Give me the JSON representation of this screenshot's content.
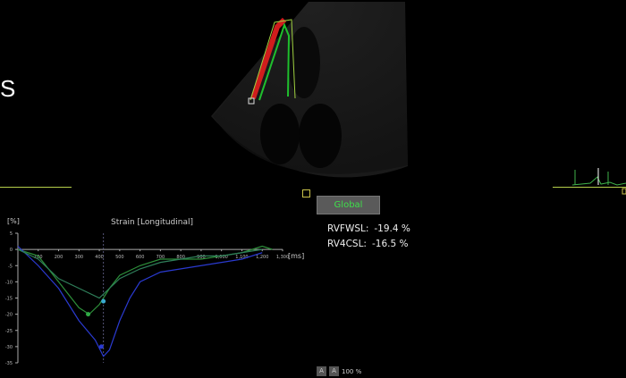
{
  "view_letter": "S",
  "global_button": "Global",
  "measurements": [
    {
      "label": "RVFWSL:",
      "value": "-19.4 %"
    },
    {
      "label": "RV4CSL:",
      "value": "-16.5 %"
    }
  ],
  "chart": {
    "title": "Strain [Longitudinal]",
    "ylabel": "[%]",
    "xunit": "[ms]"
  },
  "zoom": {
    "btn1": "A",
    "btn2": "A",
    "level": "100 %"
  },
  "chart_data": {
    "type": "line",
    "title": "Strain [Longitudinal]",
    "xlabel": "[ms]",
    "ylabel": "[%]",
    "xlim": [
      0,
      1300
    ],
    "ylim": [
      -35,
      5
    ],
    "x_ticks": [
      100,
      200,
      300,
      400,
      500,
      600,
      700,
      800,
      900,
      "1,000",
      "1,100",
      "1,200",
      "1,300"
    ],
    "y_ticks": [
      5,
      0,
      -5,
      -10,
      -15,
      -20,
      -25,
      -30,
      -35
    ],
    "series": [
      {
        "color": "#2d8f3a",
        "x": [
          0,
          100,
          200,
          300,
          350,
          400,
          450,
          500,
          600,
          700,
          800,
          900,
          1000,
          1100,
          1200,
          1250
        ],
        "y": [
          0,
          -2,
          -10,
          -18,
          -20,
          -17,
          -12,
          -8,
          -5,
          -3,
          -3,
          -3,
          -2,
          -1,
          1,
          0
        ]
      },
      {
        "color": "#2a3ad0",
        "x": [
          0,
          100,
          200,
          300,
          380,
          420,
          450,
          500,
          550,
          600,
          700,
          800,
          900,
          1000,
          1100,
          1200
        ],
        "y": [
          1,
          -5,
          -12,
          -22,
          -28,
          -33,
          -31,
          -22,
          -15,
          -10,
          -7,
          -6,
          -5,
          -4,
          -3,
          -1
        ]
      },
      {
        "color": "#2f7f5a",
        "x": [
          0,
          100,
          200,
          300,
          400,
          450,
          500,
          600,
          700,
          800,
          900,
          1000,
          1100,
          1200
        ],
        "y": [
          0,
          -3,
          -9,
          -12,
          -15,
          -12,
          -9,
          -6,
          -4,
          -3,
          -2,
          -2,
          -1,
          0
        ]
      }
    ],
    "markers": [
      {
        "x": 345,
        "y": -20,
        "color": "#2faa45"
      },
      {
        "x": 420,
        "y": -16,
        "color": "#3aaad0"
      },
      {
        "x": 410,
        "y": -30,
        "color": "#2a3ad0"
      }
    ],
    "vline_x": 420
  }
}
